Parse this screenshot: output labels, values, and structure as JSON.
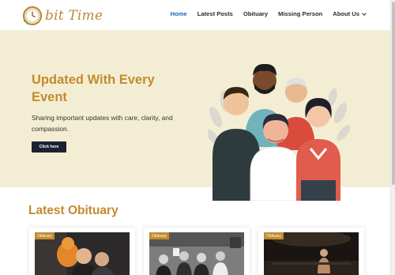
{
  "brand": {
    "name": "bit Time"
  },
  "nav": {
    "items": [
      {
        "label": "Home",
        "active": true
      },
      {
        "label": "Latest Posts",
        "active": false
      },
      {
        "label": "Obituary",
        "active": false
      },
      {
        "label": "Missing Person",
        "active": false
      },
      {
        "label": "About Us",
        "active": false
      }
    ]
  },
  "hero": {
    "title": "Updated With Every Event",
    "subtitle": "Sharing important updates with care, clarity, and compassion.",
    "button_label": "Click here"
  },
  "section": {
    "title": "Latest Obituary"
  },
  "cards": [
    {
      "badge": "Obituary"
    },
    {
      "badge": "Obituary"
    },
    {
      "badge": "Obituary"
    }
  ],
  "colors": {
    "accent": "#c48a2e",
    "hero_bg": "#f3eed3",
    "nav_active": "#1f5fbf",
    "button_bg": "#1e2230"
  }
}
